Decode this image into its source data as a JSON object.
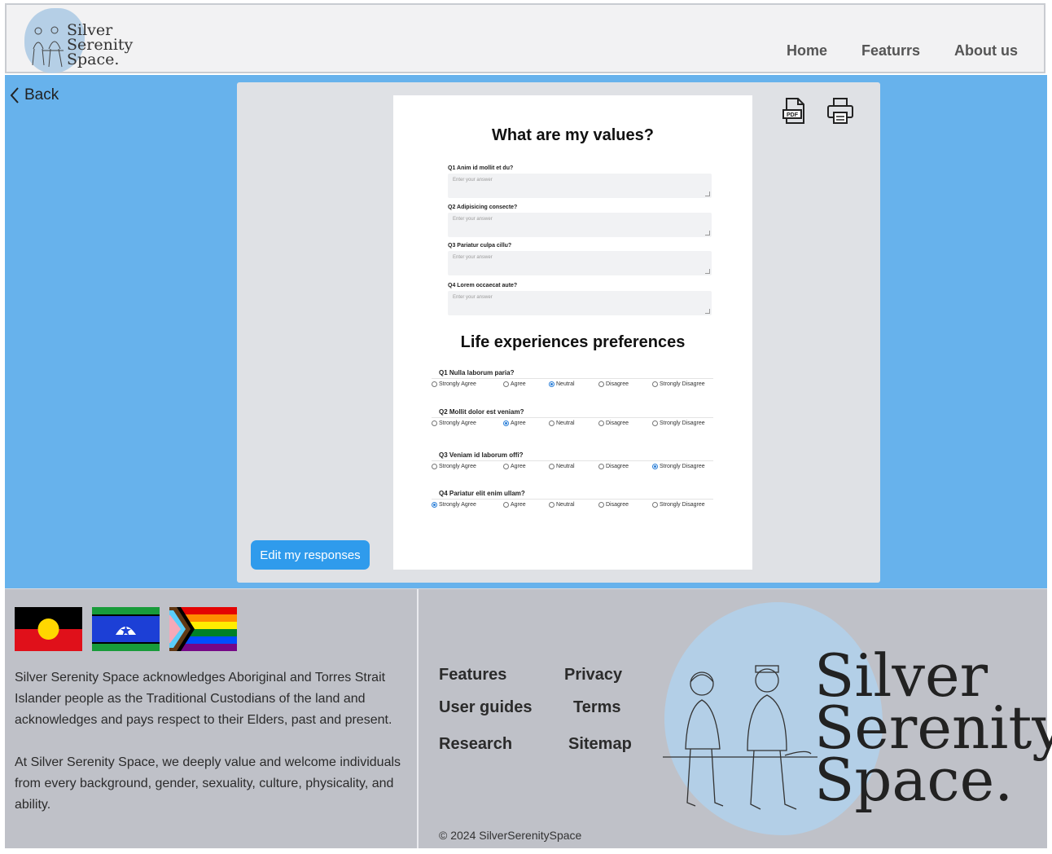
{
  "header": {
    "logo_text": [
      "Silver",
      "Serenity",
      "Space."
    ],
    "nav": [
      "Home",
      "Featurrs",
      "About us"
    ]
  },
  "main": {
    "back_label": "Back",
    "tools": [
      "pdf-icon",
      "printer-icon"
    ],
    "values_title": "What are my values?",
    "value_questions": [
      {
        "label": "Q1 Anim id mollit et du?",
        "placeholder": "Enter your answer"
      },
      {
        "label": "Q2 Adipisicing consecte?",
        "placeholder": "Enter your answer"
      },
      {
        "label": "Q3 Pariatur culpa cillu?",
        "placeholder": "Enter your answer"
      },
      {
        "label": "Q4 Lorem occaecat aute?",
        "placeholder": "Enter your answer"
      }
    ],
    "prefs_title": "Life experiences preferences",
    "options": [
      "Strongly Agree",
      "Agree",
      "Neutral",
      "Disagree",
      "Strongly Disagree"
    ],
    "pref_questions": [
      {
        "label": "Q1 Nulla laborum paria?",
        "selected": 2
      },
      {
        "label": "Q2 Mollit dolor est veniam?",
        "selected": 1
      },
      {
        "label": "Q3 Veniam id laborum offi?",
        "selected": 4
      },
      {
        "label": "Q4 Pariatur elit enim ullam?",
        "selected": 0
      }
    ],
    "edit_button": "Edit my responses",
    "accent_color": "#67b2ec",
    "button_color": "#2f9bec"
  },
  "footer": {
    "ack_1": "Silver Serenity Space acknowledges Aboriginal and Torres Strait Islander people as the Traditional Custodians of the land  and acknowledges and pays respect to their Elders, past and present.",
    "ack_2": "At Silver Serenity Space, we deeply value and welcome individuals from every background, gender, sexuality, culture, physicality, and ability.",
    "links": [
      "Features",
      "Privacy",
      "User guides",
      "Terms",
      "Research",
      "Sitemap"
    ],
    "copyright": "© 2024 SilverSerenitySpace",
    "logo_text": [
      "Silver",
      "Serenity",
      "Space."
    ]
  }
}
